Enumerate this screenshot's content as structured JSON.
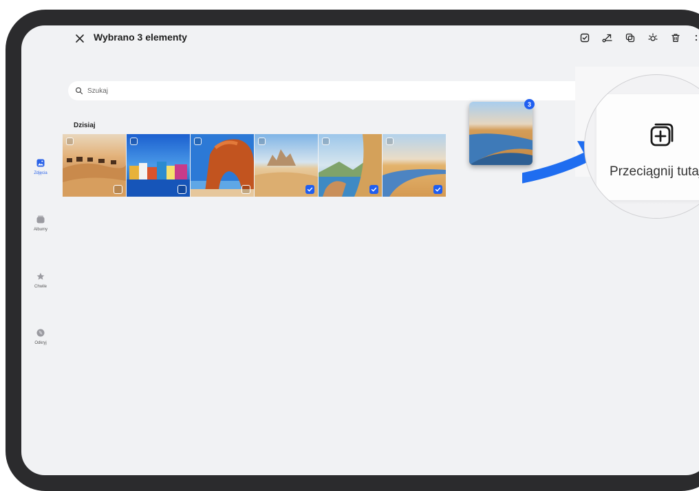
{
  "header": {
    "title": "Wybrano 3 elementy",
    "actions": [
      {
        "icon": "select-all-icon"
      },
      {
        "icon": "share-icon"
      },
      {
        "icon": "collage-icon"
      },
      {
        "icon": "brightness-icon"
      },
      {
        "icon": "delete-icon"
      },
      {
        "icon": "more-icon"
      }
    ]
  },
  "search": {
    "placeholder": "Szukaj"
  },
  "sidebar": {
    "items": [
      {
        "label": "Zdjęcia",
        "icon": "photos-icon",
        "active": true
      },
      {
        "label": "Albumy",
        "icon": "albums-icon",
        "active": false
      },
      {
        "label": "Chwile",
        "icon": "star-icon",
        "active": false
      },
      {
        "label": "Odkryj",
        "icon": "discover-icon",
        "active": false
      }
    ]
  },
  "section": {
    "title": "Dzisiaj"
  },
  "photos": [
    {
      "subject": "desert-camels",
      "selected": false
    },
    {
      "subject": "colorful-houses",
      "selected": false
    },
    {
      "subject": "rock-arch-beach",
      "selected": false
    },
    {
      "subject": "desert-rock",
      "selected": true
    },
    {
      "subject": "sail-lake",
      "selected": true
    },
    {
      "subject": "desert-river",
      "selected": true
    }
  ],
  "drag": {
    "count": "3"
  },
  "drop_target": {
    "label": "Przeciągnij tutaj"
  },
  "colors": {
    "accent": "#1f5ef0",
    "background": "#f1f2f4",
    "frame": "#2b2b2d"
  }
}
